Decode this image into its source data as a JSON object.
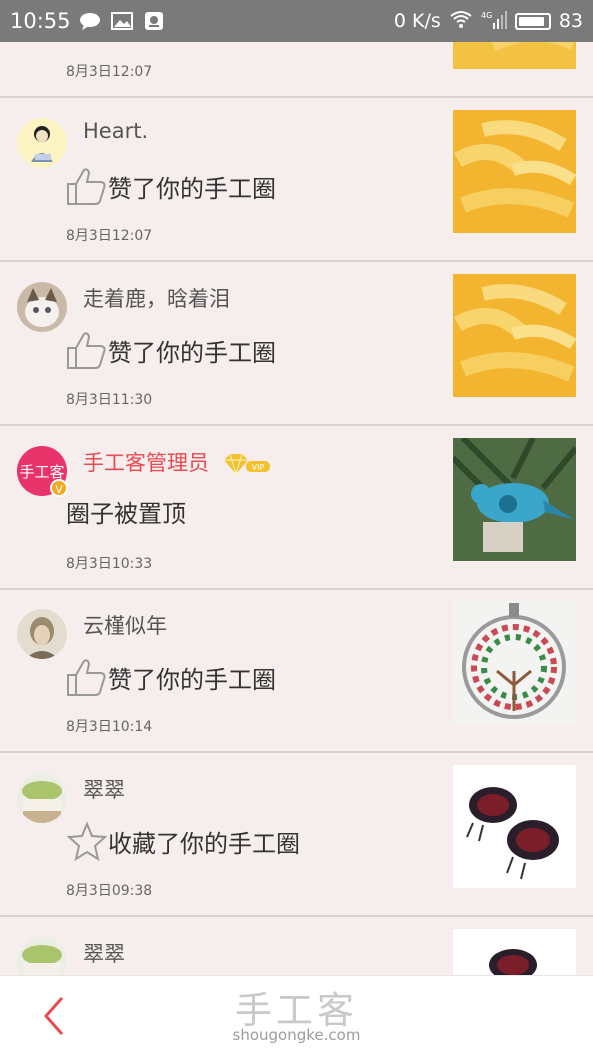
{
  "status_bar": {
    "time": "10:55",
    "net_speed": "0 K/s",
    "signal": "4G",
    "battery": "83"
  },
  "items": [
    {
      "user": "",
      "action": "",
      "time": "8月3日12:07",
      "action_icon": "",
      "thumb": "orange-peel-thumbnail"
    },
    {
      "user": "Heart.",
      "action": "赞了你的手工圈",
      "time": "8月3日12:07",
      "action_icon": "thumbs-up-icon",
      "thumb": "orange-peel-thumbnail"
    },
    {
      "user": "走着鹿，晗着泪",
      "action": "赞了你的手工圈",
      "time": "8月3日11:30",
      "action_icon": "thumbs-up-icon",
      "thumb": "orange-peel-thumbnail"
    },
    {
      "user": "手工客管理员",
      "badge": "VIP",
      "action": "圈子被置顶",
      "time": "8月3日10:33",
      "action_icon": "",
      "thumb": "blue-bird-thumbnail"
    },
    {
      "user": "云槿似年",
      "action": "赞了你的手工圈",
      "time": "8月3日10:14",
      "action_icon": "thumbs-up-icon",
      "thumb": "wire-tree-pendant-thumbnail"
    },
    {
      "user": "翠翠",
      "action": "收藏了你的手工圈",
      "time": "8月3日09:38",
      "action_icon": "star-icon",
      "thumb": "beaded-bugs-thumbnail"
    },
    {
      "user": "翠翠",
      "action": "",
      "time": "",
      "action_icon": "",
      "thumb": "beaded-bugs-thumbnail"
    }
  ],
  "avatar_admin_text": "手工客",
  "footer": {
    "brand": "手工客",
    "domain": "shougongke.com"
  },
  "colors": {
    "status_bar": "#7a7a7a",
    "background": "#f6eeed",
    "accent_red": "#e84a52",
    "vip_gold": "#f2c12e"
  }
}
